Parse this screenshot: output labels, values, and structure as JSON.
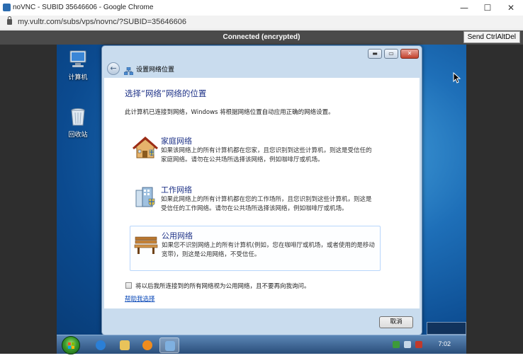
{
  "browser": {
    "tab_title": "noVNC - SUBID 35646606 - Google Chrome",
    "url": "my.vultr.com/subs/vps/novnc/?SUBID=35646606",
    "minimize_glyph": "—",
    "maximize_glyph": "☐",
    "close_glyph": "✕"
  },
  "novnc": {
    "status": "Connected (encrypted)",
    "ctrl_alt_del": "Send CtrlAltDel"
  },
  "desktop": {
    "icons": [
      {
        "label": "计算机",
        "icon": "computer-icon"
      },
      {
        "label": "回收站",
        "icon": "recycle-bin-icon"
      }
    ]
  },
  "dialog": {
    "nav_title": "设置网络位置",
    "heading": "选择“网络”网络的位置",
    "description": "此计算机已连接到网络，Windows 将根据网络位置自动应用正确的网络设置。",
    "options": [
      {
        "title": "家庭网络",
        "icon": "home-network-icon",
        "text": "如果该网络上的所有计算机都在您家，且您识别到这些计算机，则这是受信任的家庭网络。请勿在公共场所选择该网络，例如咖啡厅或机场。",
        "selected": false
      },
      {
        "title": "工作网络",
        "icon": "work-network-icon",
        "text": "如果此网络上的所有计算机都在您的工作场所，且您识别到这些计算机，则这是受信任的工作网络。请勿在公共场所选择该网络，例如咖啡厅或机场。",
        "selected": false
      },
      {
        "title": "公用网络",
        "icon": "public-network-icon",
        "text": "如果您不识别网络上的所有计算机(例如，您在咖啡厅或机场，或者使用的是移动宽带)，则这是公用网络，不受信任。",
        "selected": true
      }
    ],
    "checkbox_label": "将以后我所连接到的所有网络视为公用网络，且不要再向我询问。",
    "checkbox_checked": false,
    "help_link": "帮助我选择",
    "cancel_label": "取消",
    "back_glyph": "←",
    "min_glyph": "▬",
    "max_glyph": "▭",
    "close_glyph": "✕"
  },
  "taskbar": {
    "clock": "7:02",
    "items": [
      "ie-icon",
      "explorer-icon",
      "media-player-icon",
      "network-dialog-icon"
    ]
  }
}
